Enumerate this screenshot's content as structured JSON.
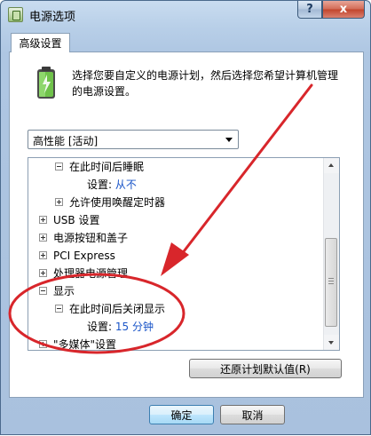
{
  "window": {
    "title": "电源选项",
    "help_label": "?",
    "close_label": "x"
  },
  "tab": {
    "label": "高级设置"
  },
  "description": "选择您要自定义的电源计划，然后选择您希望计算机管理的电源设置。",
  "plan_select": {
    "value": "高性能 [活动]"
  },
  "tree": {
    "items": [
      {
        "label": "在此时间后睡眠",
        "expander": "minus"
      },
      {
        "prefix": "设置: ",
        "value": "从不"
      },
      {
        "label": "允许使用唤醒定时器",
        "expander": "plus"
      },
      {
        "label": "USB 设置",
        "expander": "plus"
      },
      {
        "label": "电源按钮和盖子",
        "expander": "plus"
      },
      {
        "label": "PCI Express",
        "expander": "plus"
      },
      {
        "label": "处理器电源管理",
        "expander": "plus"
      },
      {
        "label": "显示",
        "expander": "minus"
      },
      {
        "label": "在此时间后关闭显示",
        "expander": "minus"
      },
      {
        "prefix": "设置: ",
        "value": "15 分钟"
      },
      {
        "label": "\"多媒体\"设置",
        "expander": "plus"
      }
    ]
  },
  "buttons": {
    "restore": "还原计划默认值(R)",
    "ok": "确定",
    "cancel": "取消"
  },
  "colors": {
    "annotation": "#d8262b",
    "setting_value": "#1a55c8"
  }
}
